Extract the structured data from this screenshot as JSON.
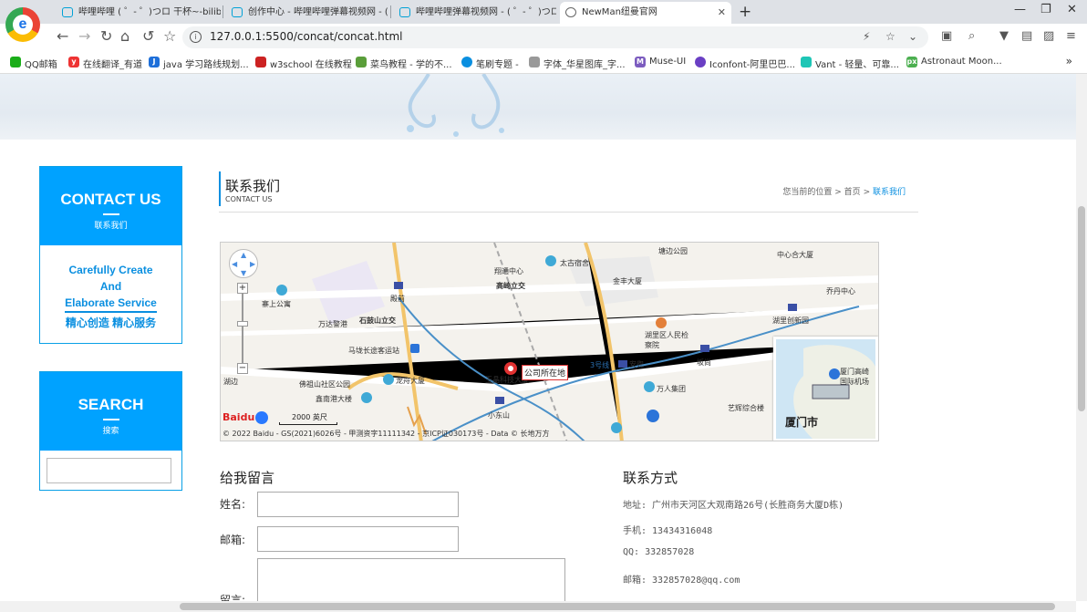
{
  "browser": {
    "tabs": [
      {
        "title": "哔哩哔哩 ( ゜- ゜)つロ 干杯~-bilibili",
        "active": false
      },
      {
        "title": "创作中心 - 哔哩哔哩弹幕视频网 - (",
        "active": false
      },
      {
        "title": "哔哩哔哩弹幕视频网 - ( ゜- ゜)つロ",
        "active": false
      },
      {
        "title": "NewMan纽曼官网",
        "active": true
      }
    ],
    "url": "127.0.0.1:5500/concat/concat.html",
    "bookmarks": [
      "QQ邮箱",
      "在线翻译_有道",
      "java 学习路线规划...",
      "w3school 在线教程",
      "菜鸟教程 - 学的不...",
      "笔刷专题 -",
      "字体_华星图库_字...",
      "Muse-UI",
      "Iconfont-阿里巴巴...",
      "Vant - 轻量、可靠...",
      "Astronaut Moon..."
    ],
    "bookmarks_more": "»"
  },
  "sidebar": {
    "contact": {
      "title": "CONTACT US",
      "subtitle": "联系我们"
    },
    "slogan": {
      "line1": "Carefully Create",
      "line2": "And",
      "line3": "Elaborate Service",
      "line4": "精心创造 精心服务"
    },
    "search": {
      "title": "SEARCH",
      "subtitle": "搜索",
      "value": ""
    }
  },
  "content": {
    "title": "联系我们",
    "subtitle": "CONTACT US",
    "breadcrumb": {
      "prefix": "您当前的位置",
      "home": "首页",
      "current": "联系我们",
      "sep": ">"
    }
  },
  "map": {
    "pin_label": "公司所在地",
    "labels": [
      "塘边公园",
      "中心合大厦",
      "翔通中心",
      "太古宿舍",
      "金丰大厦",
      "乔丹中心",
      "殿前",
      "寨上公寓",
      "高崎立交",
      "万达警港",
      "石鼓山立交",
      "湖里创新园",
      "湖里区人民检察院",
      "马垅长途客运站",
      "安兜",
      "坂尚",
      "佛祖山社区公园",
      "龙舟大厦",
      "玉晶科技大厦",
      "万人集团",
      "湖边",
      "鑫南港大楼",
      "小东山",
      "艺辉综合楼",
      "厦门高崎国际机场",
      "1号线",
      "3号线"
    ],
    "mini_label": "厦门市",
    "scale": "2000 英尺",
    "copyright": "© 2022 Baidu - GS(2021)6026号 - 甲测资字11111342 - 京ICP证030173号 - Data © 长地万方",
    "logo_text": "Baidu"
  },
  "form": {
    "title": "给我留言",
    "name_label": "姓名:",
    "email_label": "邮箱:",
    "message_label": "留言:"
  },
  "contact_info": {
    "title": "联系方式",
    "address": "地址: 广州市天河区大观南路26号(长胜商务大厦D栋)",
    "phone": "手机: 13434316048",
    "qq": "QQ: 332857028",
    "email": "邮箱: 332857028@qq.com"
  }
}
